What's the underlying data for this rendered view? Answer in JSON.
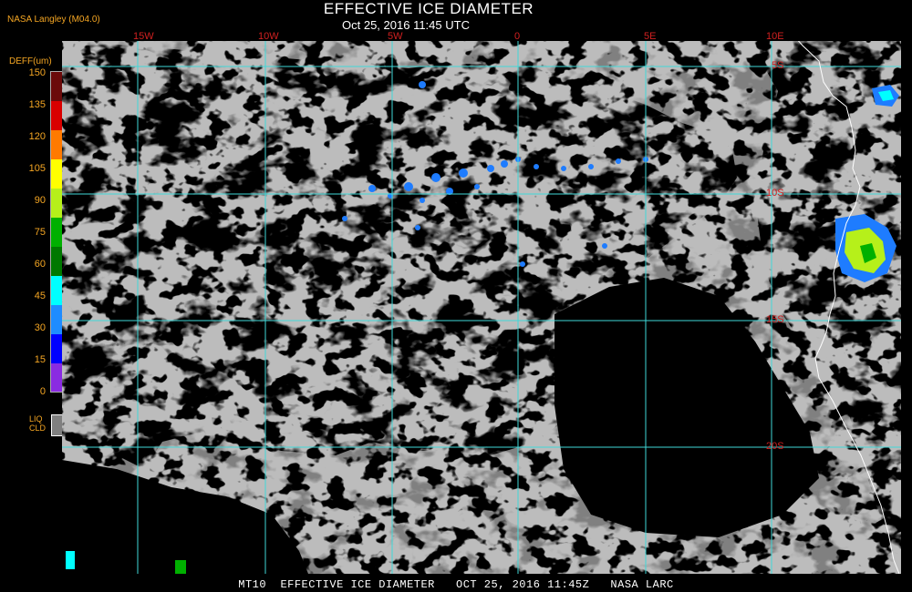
{
  "header": {
    "title": "EFFECTIVE ICE DIAMETER",
    "subtitle": "Oct 25, 2016 11:45 UTC",
    "credit": "NASA Langley (M04.0)"
  },
  "legend": {
    "title": "DEFF(um)",
    "ticks": [
      "150",
      "135",
      "120",
      "105",
      "90",
      "75",
      "60",
      "45",
      "30",
      "15",
      "0"
    ],
    "colors": [
      "#6b0b0b",
      "#d90000",
      "#ff7a00",
      "#ffff00",
      "#b6f01a",
      "#00b000",
      "#007800",
      "#00ffff",
      "#1e8cff",
      "#0000ff",
      "#8a2be2"
    ],
    "liq_line1": "LIQ",
    "liq_line2": "CLD",
    "liq_color": "#808080"
  },
  "map": {
    "lon_labels": [
      "15W",
      "10W",
      "5W",
      "0",
      "5E",
      "10E"
    ],
    "lat_labels": [
      "5S",
      "10S",
      "15S",
      "20S"
    ],
    "grid_color": "#3fd8d8",
    "coast_color": "#ffffff",
    "liquid_cloud_color": "#808080",
    "clear_sky_color": "#000000",
    "ice_color": "#1e7cff"
  },
  "footer": {
    "text": "MT10  EFFECTIVE ICE DIAMETER   OCT 25, 2016 11:45Z   NASA LARC"
  }
}
